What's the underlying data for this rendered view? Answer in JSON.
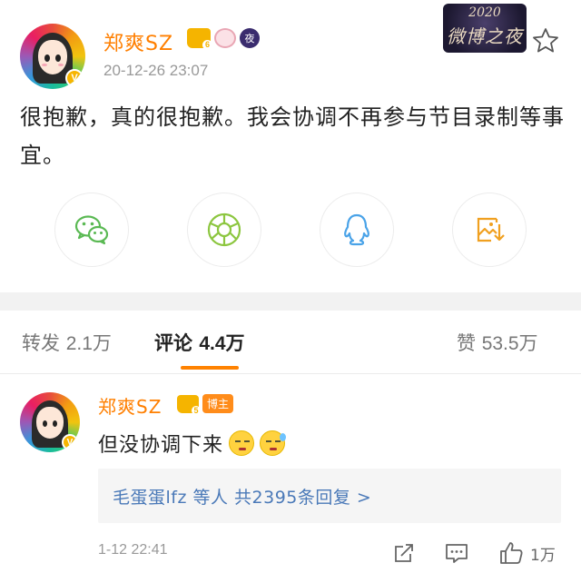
{
  "post": {
    "username": "郑爽SZ",
    "timestamp": "20-12-26 23:07",
    "night_badge": "夜",
    "event_banner": {
      "year": "2020",
      "name": "微博之夜"
    },
    "body": "很抱歉，真的很抱歉。我会协调不再参与节目录制等事宜。",
    "share_buttons": [
      "wechat-icon",
      "moments-icon",
      "qq-icon",
      "save-image-icon"
    ]
  },
  "tabs": {
    "repost": {
      "label": "转发",
      "count": "2.1万"
    },
    "comment": {
      "label": "评论",
      "count": "4.4万"
    },
    "like": {
      "label": "赞",
      "count": "53.5万"
    }
  },
  "comment": {
    "username": "郑爽SZ",
    "host_tag": "博主",
    "text": "但没协调下来",
    "replies_summary": "毛蛋蛋lfz 等人  共2395条回复 >",
    "time": "1-12 22:41",
    "like_count": "1万"
  },
  "colors": {
    "accent": "#ff8200",
    "username": "#ff7f00",
    "link": "#4a79b8",
    "muted": "#999999"
  }
}
